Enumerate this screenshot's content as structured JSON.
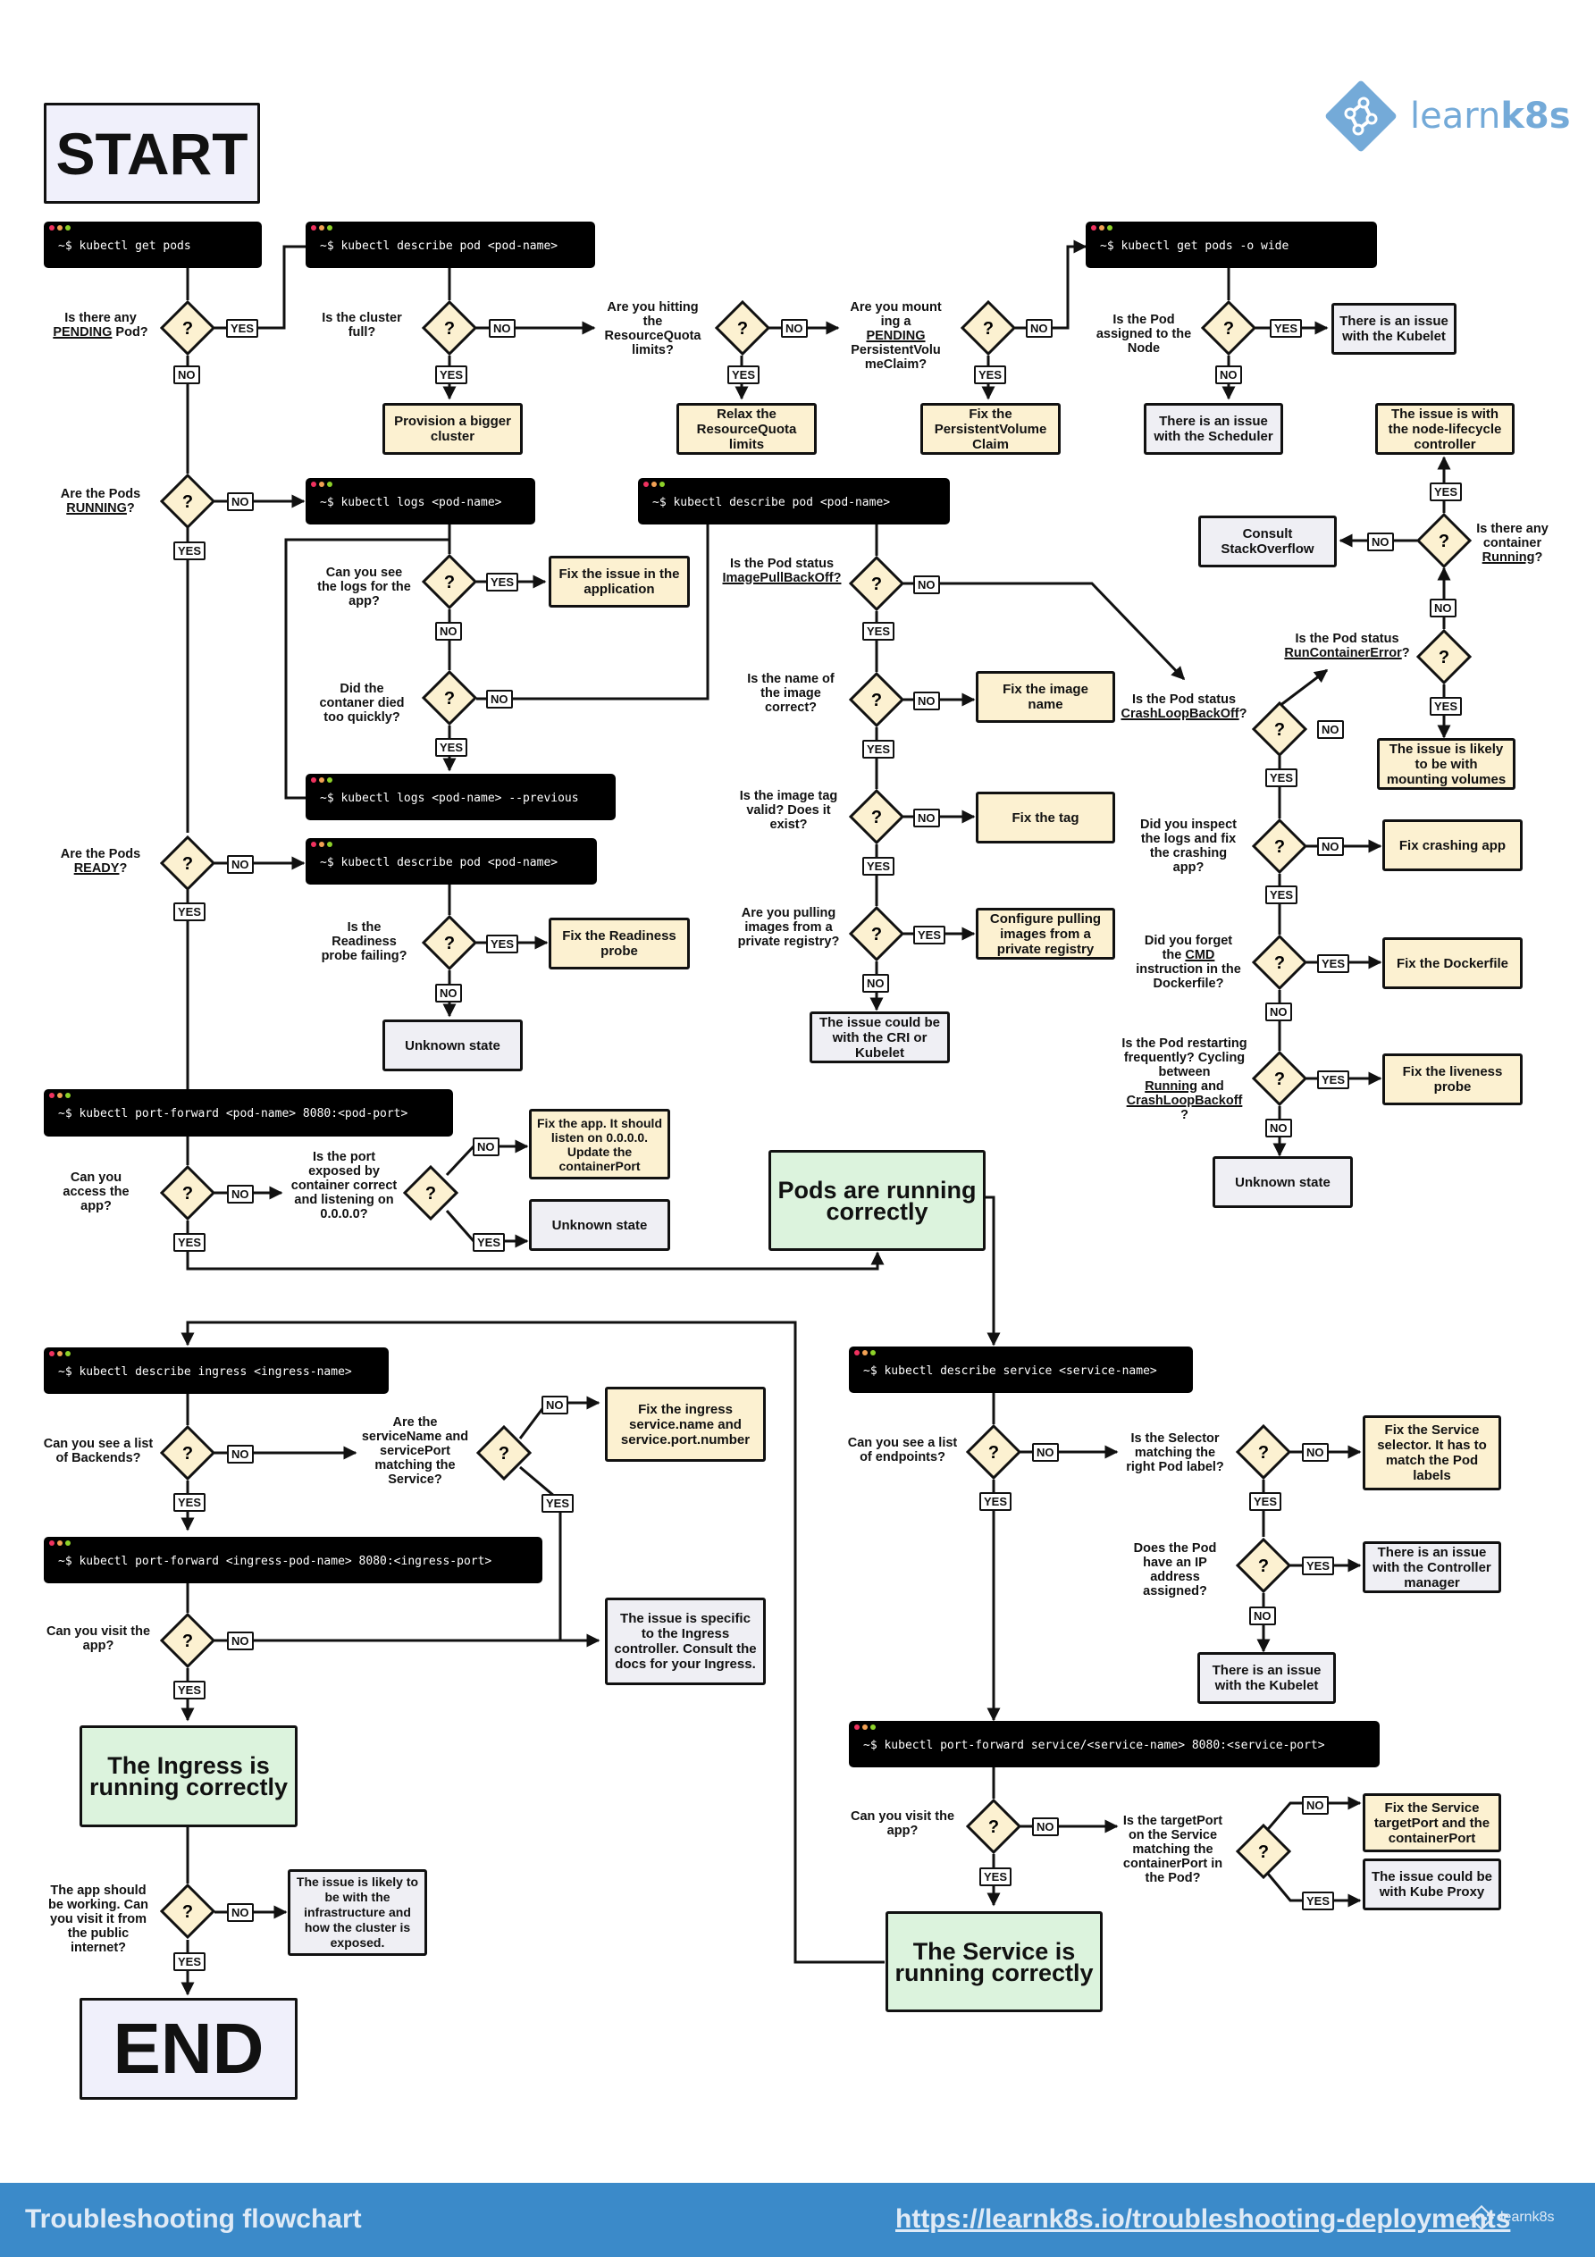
{
  "brand": {
    "name_light": "learn",
    "name_bold": "k8s",
    "color": "#74aad8"
  },
  "colors": {
    "fix": "#fcf1d1",
    "info": "#efeff4",
    "success": "#dcf3dd",
    "terminal": "#000000",
    "footer": "#3b8ac9",
    "dot_red": "#f0325f",
    "dot_orange": "#f2a154",
    "dot_green": "#8ed22a"
  },
  "start_label": "START",
  "end_label": "END",
  "answers": {
    "yes": "YES",
    "no": "NO",
    "question_mark": "?"
  },
  "terminals": {
    "get_pods": "~$ kubectl get pods",
    "describe_pod_1": "~$ kubectl describe pod <pod-name>",
    "get_pods_wide": "~$ kubectl get pods -o wide",
    "logs": "~$ kubectl logs <pod-name>",
    "describe_pod_2": "~$ kubectl describe pod <pod-name>",
    "logs_previous": "~$ kubectl logs <pod-name> --previous",
    "describe_pod_3": "~$ kubectl describe pod <pod-name>",
    "port_forward_pod": "~$ kubectl port-forward <pod-name> 8080:<pod-port>",
    "describe_ingress": "~$ kubectl describe ingress <ingress-name>",
    "port_forward_ingress": "~$ kubectl port-forward <ingress-pod-name> 8080:<ingress-port>",
    "describe_service": "~$ kubectl describe service <service-name>",
    "port_forward_service": "~$ kubectl port-forward service/<service-name> 8080:<service-port>"
  },
  "questions": {
    "pending_pre": "Is there any",
    "pending_u": "PENDING",
    "pending_post": " Pod?",
    "cluster_full": "Is the cluster full?",
    "resource_quota": "Are you hitting the ResourceQuota limits?",
    "pvc_pre": "Are you mounting a",
    "pvc_u": "PENDING",
    "pvc_post": "PersistentVolumeClaim?",
    "assigned_node": "Is the Pod assigned to the Node",
    "running_pre": "Are the Pods",
    "running_u": "RUNNING",
    "running_post": "?",
    "see_logs": "Can you see the logs for the app?",
    "died_quickly": "Did the contaner died too quickly?",
    "imagepull_pre": "Is the Pod status",
    "imagepull_u": "ImagePullBackOff?",
    "image_name": "Is the name of the image correct?",
    "image_tag": "Is the image tag valid? Does it exist?",
    "private_registry": "Are you pulling images from a private registry?",
    "crashloop_pre": "Is the Pod status",
    "crashloop_u": "CrashLoopBackOff",
    "crashloop_post": "?",
    "runcontainer_pre": "Is the Pod status",
    "runcontainer_u": "RunContainerError",
    "runcontainer_post": "?",
    "container_running_pre": "Is there any container",
    "container_running_u": "Running",
    "container_running_post": "?",
    "inspect_logs": "Did you inspect the logs and fix the crashing app?",
    "cmd_pre": "Did you forget the",
    "cmd_u": "CMD",
    "cmd_post": "instruction in the Dockerfile?",
    "restarting_pre": "Is the Pod restarting frequently? Cycling between",
    "restarting_u1": "Running",
    "restarting_mid": " and",
    "restarting_u2": "CrashLoopBackoff",
    "restarting_post": "?",
    "ready_pre": "Are the Pods",
    "ready_u": "READY",
    "ready_post": "?",
    "readiness_failing": "Is the Readiness probe failing?",
    "access_app": "Can you access the app?",
    "port_exposed": "Is the port exposed by container correct and listening on 0.0.0.0?",
    "backends": "Can you see a list of Backends?",
    "service_name_port": "Are the serviceName and servicePort matching the Service?",
    "visit_app_ingress": "Can you visit the app?",
    "public_internet": "The app should be working. Can you visit it from the public internet?",
    "endpoints": "Can you see a list of endpoints?",
    "selector": "Is the Selector matching the right Pod label?",
    "pod_ip": "Does the Pod have an IP address assigned?",
    "visit_app_service": "Can you visit the app?",
    "target_port": "Is the targetPort on the Service matching the containerPort in the Pod?"
  },
  "outcomes": {
    "bigger_cluster": "Provision a bigger cluster",
    "relax_quota": "Relax the ResourceQuota limits",
    "fix_pvc": "Fix the PersistentVolume Claim",
    "kubelet_issue_1": "There is an issue with the Kubelet",
    "scheduler_issue": "There is an issue with the Scheduler",
    "node_lifecycle": "The issue is with the node-lifecycle controller",
    "stackoverflow": "Consult StackOverflow",
    "fix_app_issue": "Fix the issue in the application",
    "fix_image_name": "Fix the image name",
    "fix_tag": "Fix the tag",
    "private_registry": "Configure pulling images from a private registry",
    "cri_kubelet": "The issue could be with the CRI or Kubelet",
    "mounting_volumes": "The issue is likely to be with mounting volumes",
    "fix_crashing": "Fix crashing app",
    "fix_dockerfile": "Fix the Dockerfile",
    "fix_liveness": "Fix the liveness probe",
    "unknown_1": "Unknown state",
    "fix_readiness": "Fix the Readiness probe",
    "unknown_2": "Unknown state",
    "fix_listen": "Fix the app. It should listen on 0.0.0.0. Update the containerPort",
    "unknown_3": "Unknown state",
    "pods_running": "Pods are running correctly",
    "fix_ingress": "Fix the ingress service.name and service.port.number",
    "ingress_controller": "The issue is specific to the Ingress controller. Consult the docs for your Ingress.",
    "ingress_ok": "The Ingress is running correctly",
    "infrastructure": "The issue is likely to be with the infrastructure and how the cluster is exposed.",
    "fix_selector": "Fix the Service selector. It has to match the Pod labels",
    "controller_manager": "There is an issue with the Controller manager",
    "kubelet_issue_2": "There is an issue with the Kubelet",
    "fix_target_port": "Fix the Service targetPort and the containerPort",
    "kube_proxy": "The issue could be with Kube Proxy",
    "service_ok": "The Service is running correctly"
  },
  "footer": {
    "title": "Troubleshooting flowchart",
    "link": "https://learnk8s.io/troubleshooting-deployments",
    "logo_text": "learnk8s"
  }
}
